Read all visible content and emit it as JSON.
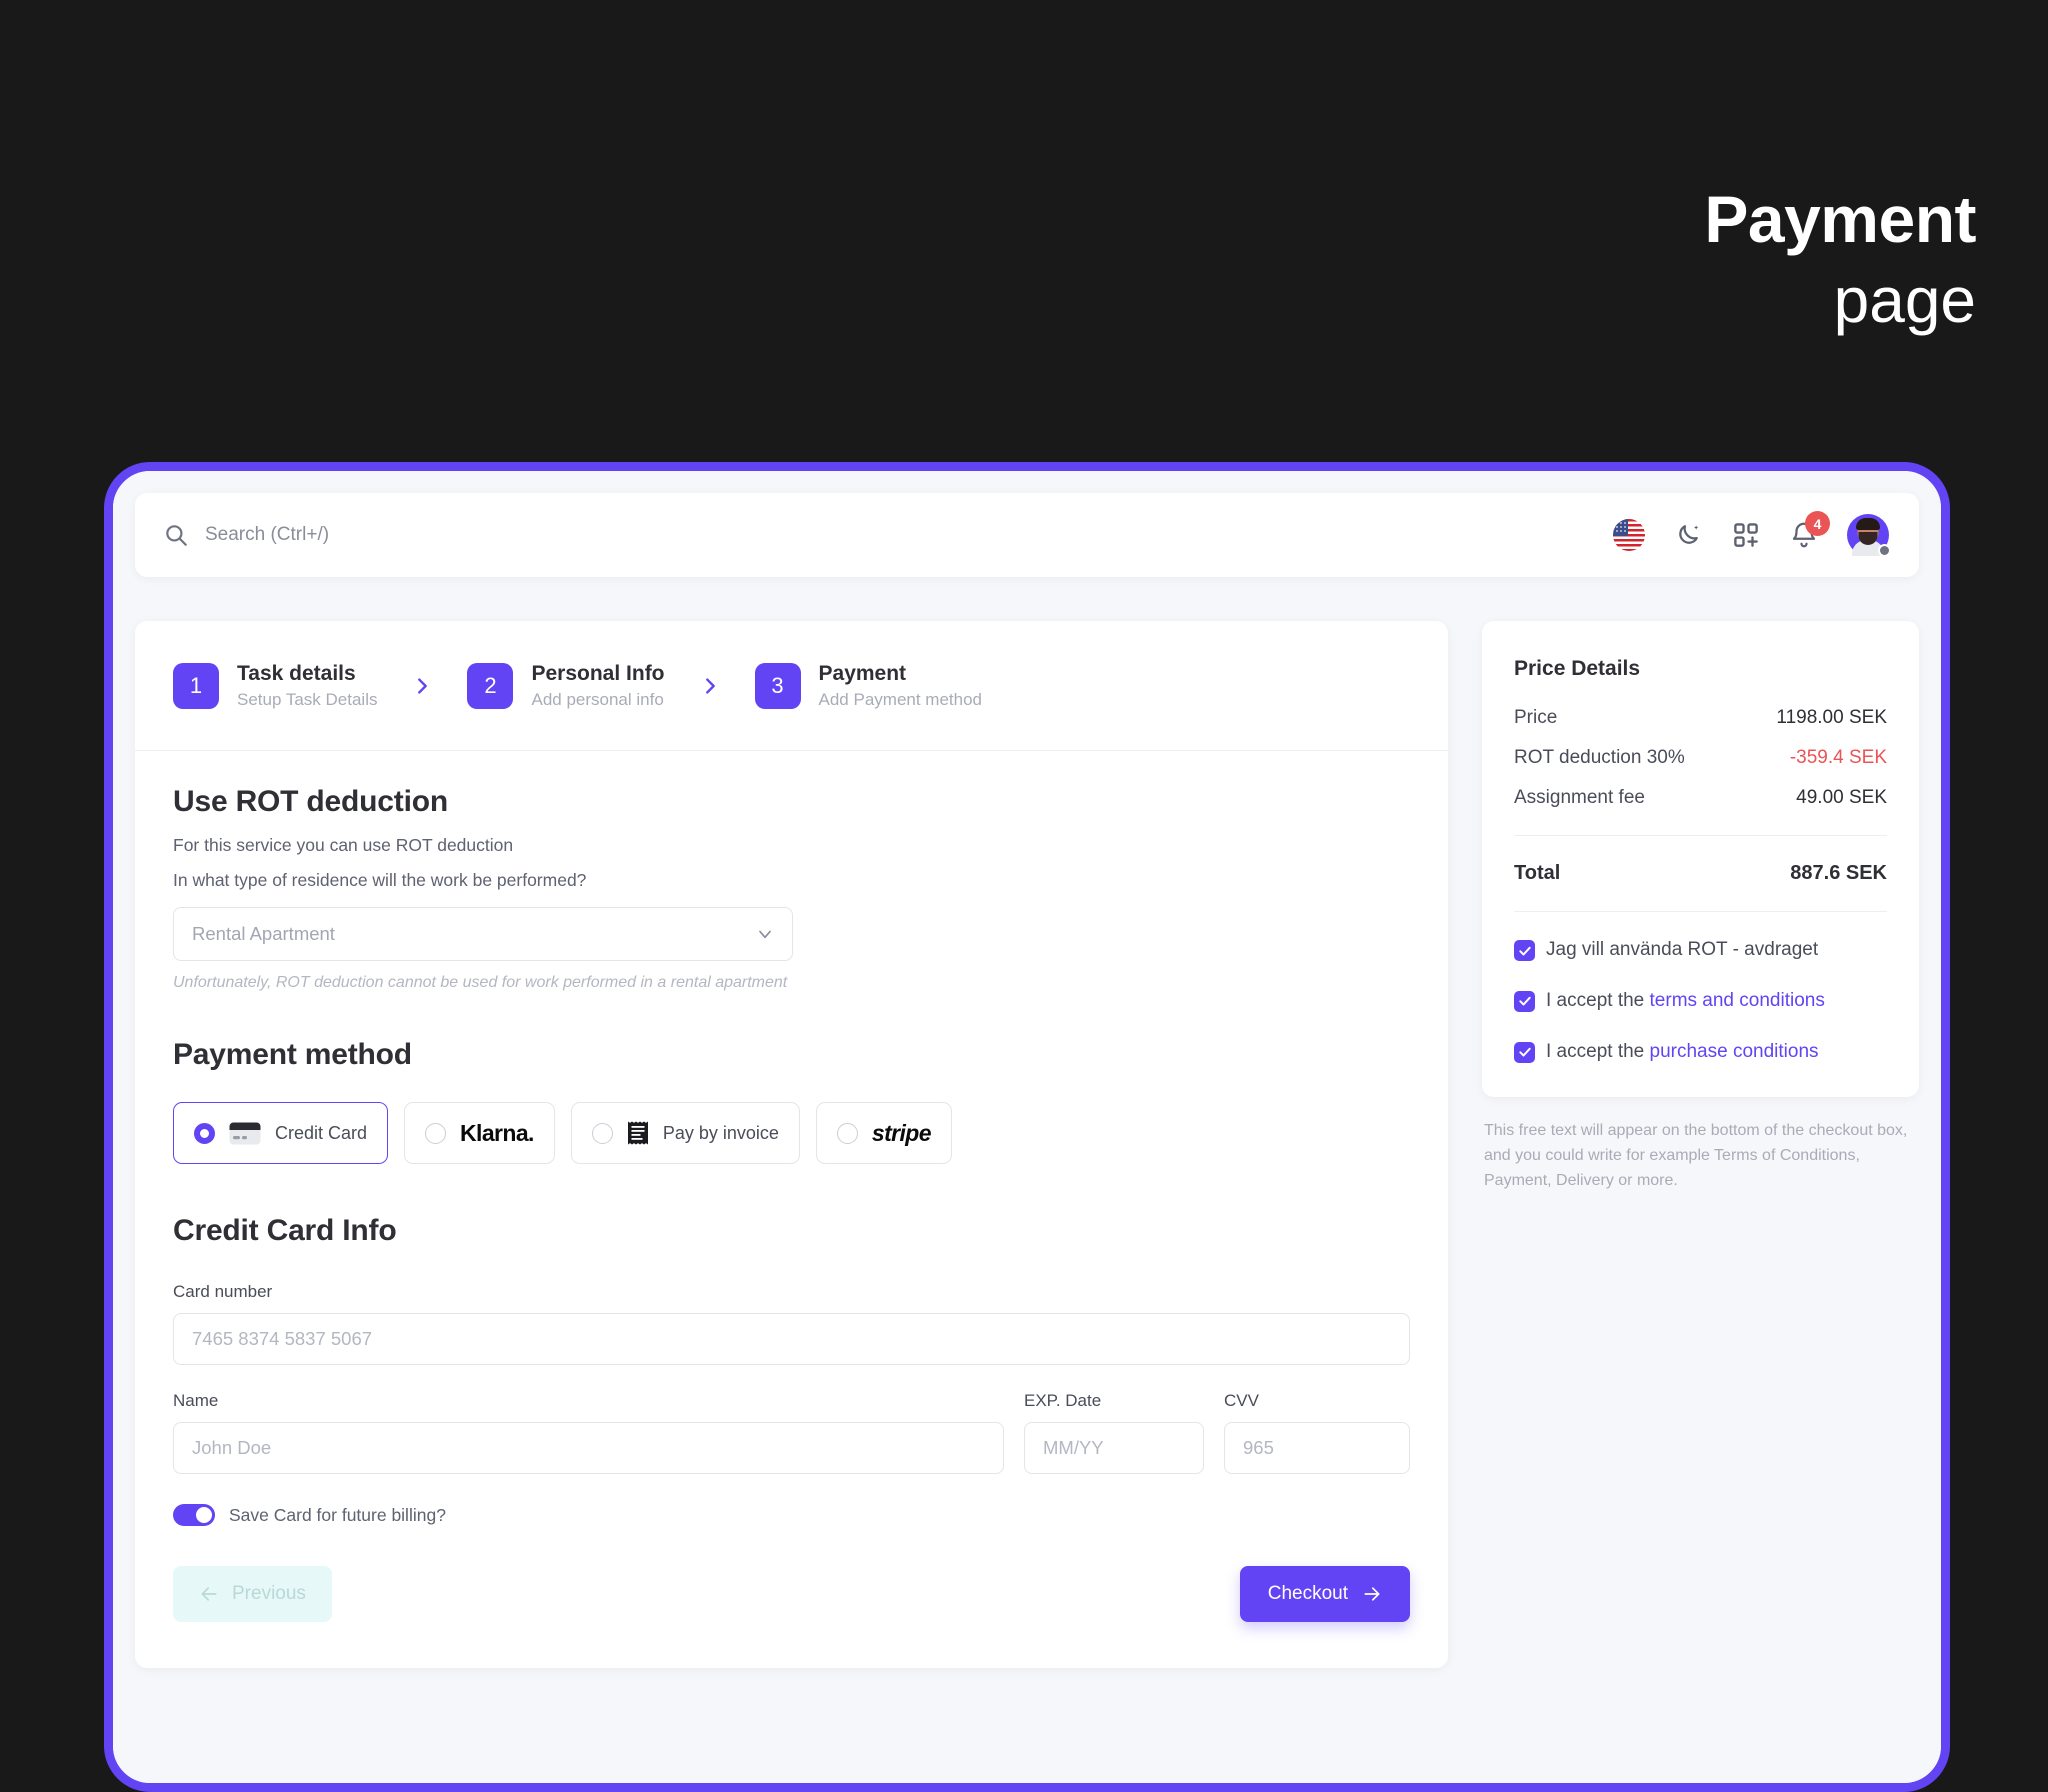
{
  "poster": {
    "title_line1": "Payment",
    "title_line2": "page"
  },
  "topbar": {
    "search_placeholder": "Search (Ctrl+/)",
    "search_value": "",
    "icons": {
      "search": "search-icon",
      "language_flag": "us-flag-icon",
      "dark_mode": "moon-icon",
      "apps": "grid-plus-icon",
      "notifications": "bell-icon",
      "avatar": "avatar"
    },
    "notification_count": "4"
  },
  "stepper": {
    "steps": [
      {
        "num": "1",
        "title": "Task details",
        "subtitle": "Setup Task Details"
      },
      {
        "num": "2",
        "title": "Personal Info",
        "subtitle": "Add personal info"
      },
      {
        "num": "3",
        "title": "Payment",
        "subtitle": "Add Payment method"
      }
    ]
  },
  "rot": {
    "heading": "Use ROT deduction",
    "description": "For this service you can use ROT deduction",
    "question": "In what type of residence will the work be performed?",
    "select_value": "Rental Apartment",
    "hint": "Unfortunately, ROT deduction cannot be used for work performed in a rental apartment"
  },
  "payment_method": {
    "heading": "Payment method",
    "options": [
      {
        "label": "Credit Card",
        "icon": "credit-card-icon",
        "selected": true
      },
      {
        "label": "Klarna.",
        "icon": "klarna-logo",
        "selected": false
      },
      {
        "label": "Pay by invoice",
        "icon": "invoice-icon",
        "selected": false
      },
      {
        "label": "stripe",
        "icon": "stripe-logo",
        "selected": false
      }
    ]
  },
  "credit_card": {
    "heading": "Credit Card Info",
    "card_number_label": "Card number",
    "card_number_placeholder": "7465 8374 5837 5067",
    "card_number_value": "",
    "name_label": "Name",
    "name_placeholder": "John Doe",
    "name_value": "",
    "exp_label": "EXP. Date",
    "exp_placeholder": "MM/YY",
    "exp_value": "",
    "cvv_label": "CVV",
    "cvv_placeholder": "965",
    "cvv_value": "",
    "save_card_label": "Save Card for future billing?",
    "save_card_on": true
  },
  "actions": {
    "previous_label": "Previous",
    "checkout_label": "Checkout"
  },
  "price_details": {
    "title": "Price Details",
    "rows": [
      {
        "label": "Price",
        "value": "1198.00 SEK",
        "negative": false
      },
      {
        "label": "ROT deduction 30%",
        "value": "-359.4 SEK",
        "negative": true
      },
      {
        "label": "Assignment fee",
        "value": "49.00 SEK",
        "negative": false
      }
    ],
    "total_label": "Total",
    "total_value": "887.6 SEK",
    "checkboxes": [
      {
        "text": "Jag vill använda ROT - avdraget",
        "link": "",
        "checked": true
      },
      {
        "text": "I accept the ",
        "link": "terms and conditions",
        "checked": true
      },
      {
        "text": "I accept the ",
        "link": "purchase conditions",
        "checked": true
      }
    ],
    "free_text": "This free text will appear on the bottom of the checkout box, and you could write for example Terms of Conditions, Payment, Delivery or more."
  },
  "colors": {
    "accent": "#6244f5",
    "danger": "#ea5455",
    "background": "#191919",
    "surface": "#f6f7fa"
  }
}
